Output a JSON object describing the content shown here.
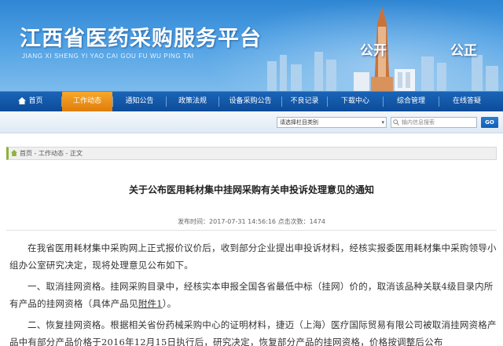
{
  "banner": {
    "title": "江西省医药采购服务平台",
    "subtitle": "JIANG XI SHENG YI YAO CAI GOU FU WU PING TAI",
    "slogan_left": "公开",
    "slogan_right": "公正"
  },
  "nav": {
    "items": [
      {
        "label": "首页",
        "icon": "home-icon"
      },
      {
        "label": "工作动态",
        "active": true
      },
      {
        "label": "通知公告"
      },
      {
        "label": "政策法规"
      },
      {
        "label": "设备采购公告"
      },
      {
        "label": "不良记录"
      },
      {
        "label": "下载中心"
      },
      {
        "label": "综合管理"
      },
      {
        "label": "在线答疑"
      }
    ]
  },
  "search": {
    "select_value": "请选择栏目类别",
    "placeholder": "输内信息搜索",
    "go_label": "GO"
  },
  "breadcrumb": "首页 - 工作动态 - 正文",
  "article": {
    "title": "关于公布医用耗材集中挂网采购有关申投诉处理意见的通知",
    "meta": "发布时间：2017-07-31 14:56:16  点击次数：1474",
    "para1": "在我省医用耗材集中采购网上正式报价议价后，收到部分企业提出申投诉材料，经核实报委医用耗材集中采购领导小组办公室研究决定，现将处理意见公布如下。",
    "para2_pre": "一、取消挂网资格。挂网采购目录中，经核实本申报全国各省最低中标（挂网）价的，取消该品种关联4级目录内所有产品的挂网资格（具体产品见",
    "para2_link": "附件1",
    "para2_post": "）。",
    "para3": "二、恢复挂网资格。根据相关省份药械采购中心的证明材料，捷迈（上海）医疗国际贸易有限公司被取消挂网资格产品中有部分产品价格于2016年12月15日执行后，研究决定，恢复部分产品的挂网资格，价格按调整后公布"
  },
  "colors": {
    "nav_bg": "#0d4c99",
    "nav_active": "#e98a12",
    "crumb_accent": "#8cb43a"
  }
}
